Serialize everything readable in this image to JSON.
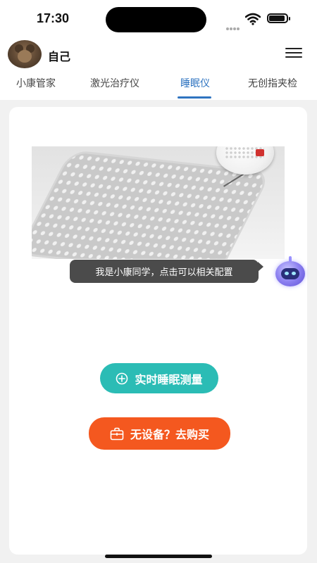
{
  "status_bar": {
    "time": "17:30"
  },
  "header": {
    "username": "自己"
  },
  "tabs": [
    {
      "label": "小康管家"
    },
    {
      "label": "激光治疗仪"
    },
    {
      "label": "睡眠仪"
    },
    {
      "label": "无创指夹检"
    }
  ],
  "assistant": {
    "tooltip": "我是小康同学，点击可以相关配置"
  },
  "actions": {
    "measure_label": "实时睡眠测量",
    "buy_label": "无设备？去购买"
  },
  "colors": {
    "active_tab": "#2f74c0",
    "measure_button": "#2bbcb5",
    "buy_button": "#f4581f"
  }
}
